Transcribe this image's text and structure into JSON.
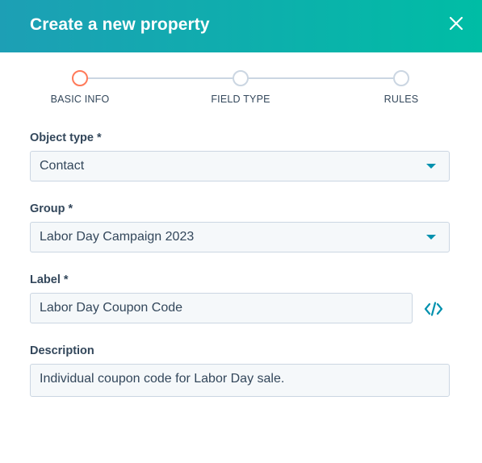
{
  "header": {
    "title": "Create a new property",
    "close_icon": "close-icon"
  },
  "stepper": {
    "steps": [
      {
        "label": "BASIC INFO",
        "state": "active"
      },
      {
        "label": "FIELD TYPE",
        "state": "upcoming"
      },
      {
        "label": "RULES",
        "state": "upcoming"
      }
    ]
  },
  "form": {
    "object_type": {
      "label": "Object type *",
      "value": "Contact"
    },
    "group": {
      "label": "Group *",
      "value": "Labor Day Campaign 2023"
    },
    "label": {
      "label": "Label *",
      "value": "Labor Day Coupon Code",
      "icon": "code-icon"
    },
    "description": {
      "label": "Description",
      "value": "Individual coupon code for Labor Day sale."
    }
  },
  "colors": {
    "header_start": "#1d9fb5",
    "header_end": "#00bda5",
    "active_step": "#ff7a59",
    "inactive_step": "#cbd6e2",
    "accent": "#0091ae",
    "text": "#33475b"
  }
}
